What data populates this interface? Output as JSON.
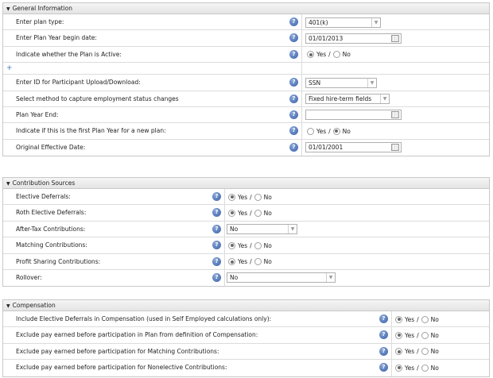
{
  "sections": {
    "general": {
      "title": "General Information",
      "plan_type": {
        "label": "Enter plan type:",
        "value": "401(k)"
      },
      "plan_year_begin": {
        "label": "Enter Plan Year begin date:",
        "value": "01/01/2013"
      },
      "plan_active": {
        "label": "Indicate whether the Plan is Active:",
        "yes": "Yes",
        "no": "No",
        "selected": "yes"
      },
      "participant_id": {
        "label": "Enter ID for Participant Upload/Download:",
        "value": "SSN"
      },
      "employment_method": {
        "label": "Select method to capture employment status changes",
        "value": "Fixed hire-term fields"
      },
      "plan_year_end": {
        "label": "Plan Year End:",
        "value": ""
      },
      "first_plan_year": {
        "label": "Indicate if this is the first Plan Year for a new plan:",
        "yes": "Yes",
        "no": "No",
        "selected": "no"
      },
      "original_effective": {
        "label": "Original Effective Date:",
        "value": "01/01/2001"
      }
    },
    "contribution": {
      "title": "Contribution Sources",
      "elective": {
        "label": "Elective Deferrals:",
        "yes": "Yes",
        "no": "No",
        "selected": "yes"
      },
      "roth": {
        "label": "Roth Elective Deferrals:",
        "yes": "Yes",
        "no": "No",
        "selected": "yes"
      },
      "after_tax": {
        "label": "After-Tax Contributions:",
        "value": "No"
      },
      "matching": {
        "label": "Matching Contributions:",
        "yes": "Yes",
        "no": "No",
        "selected": "yes"
      },
      "profit_sharing": {
        "label": "Profit Sharing Contributions:",
        "yes": "Yes",
        "no": "No",
        "selected": "yes"
      },
      "rollover": {
        "label": "Rollover:",
        "value": "No"
      }
    },
    "compensation": {
      "title": "Compensation",
      "include_elective": {
        "label": "Include Elective Deferrals in Compensation (used in Self Employed calculations only):",
        "yes": "Yes",
        "no": "No",
        "selected": "yes"
      },
      "exclude_plan": {
        "label": "Exclude pay earned before participation in Plan from definition of Compensation:",
        "yes": "Yes",
        "no": "No",
        "selected": "yes"
      },
      "exclude_matching": {
        "label": "Exclude pay earned before participation for Matching Contributions:",
        "yes": "Yes",
        "no": "No",
        "selected": "yes"
      },
      "exclude_nonelective": {
        "label": "Exclude pay earned before participation for Nonelective Contributions:",
        "yes": "Yes",
        "no": "No",
        "selected": "yes"
      }
    }
  },
  "colors": {
    "header_bg": "#e8e8e8",
    "help_icon": "#3a5fa8",
    "border": "#c8c8c8"
  },
  "icons": {
    "help": "help-icon",
    "calendar": "calendar-icon",
    "add": "plus-icon",
    "collapse": "triangle-down-icon"
  }
}
